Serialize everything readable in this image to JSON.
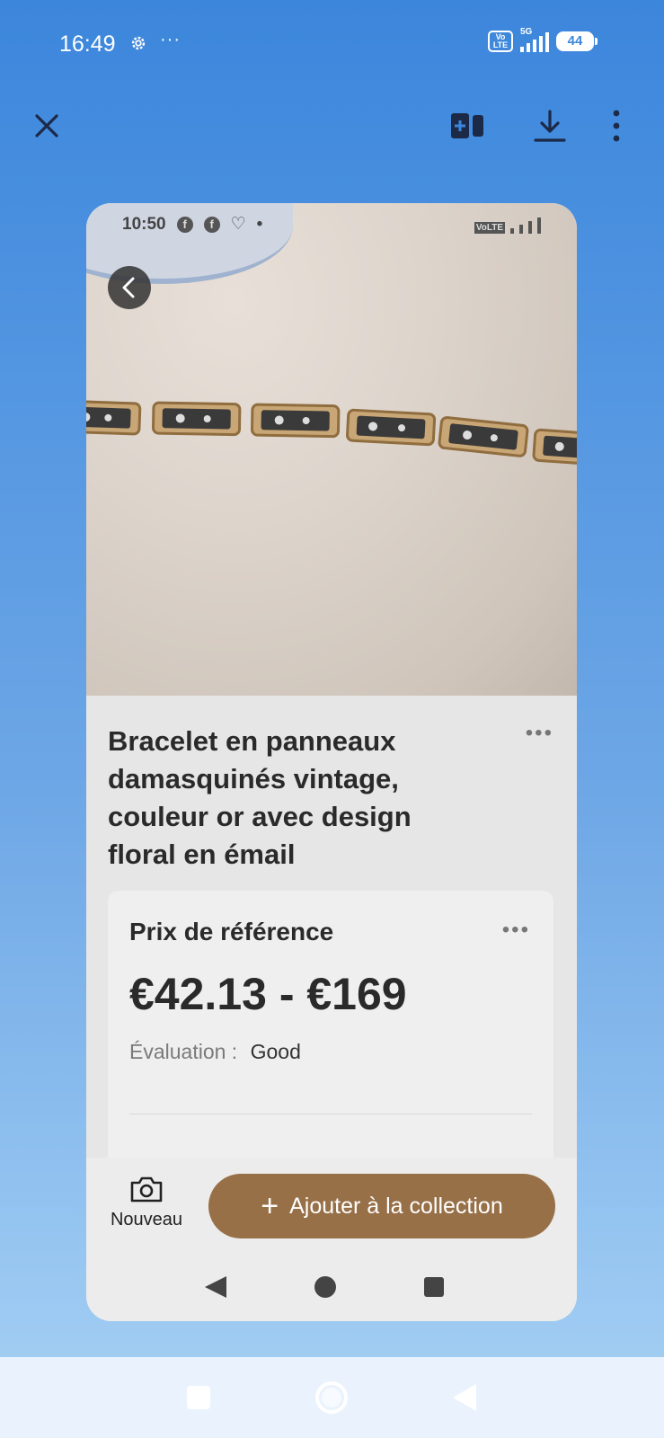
{
  "status_bar": {
    "time": "16:49",
    "network": "5G",
    "volte": "Vo LTE",
    "battery": "44"
  },
  "toolbar": {
    "icons": [
      "close-icon",
      "add-page-icon",
      "download-icon",
      "more-vertical-icon"
    ]
  },
  "screenshot": {
    "inner_status": {
      "time": "10:50",
      "volte": "VoLTE"
    },
    "product_title": "Bracelet en panneaux damasquinés vintage, couleur or avec design floral en émail",
    "price_card": {
      "label": "Prix de référence",
      "price_range": "€42.13 - €169",
      "rating_label": "Évaluation :",
      "rating_value": "Good"
    },
    "new_label": "Nouveau",
    "collect_label": "Ajouter à la collection",
    "collect_plus": "+"
  },
  "colors": {
    "accent": "#987048",
    "background_top": "#3c86dc",
    "background_bottom": "#a8d1f4"
  }
}
